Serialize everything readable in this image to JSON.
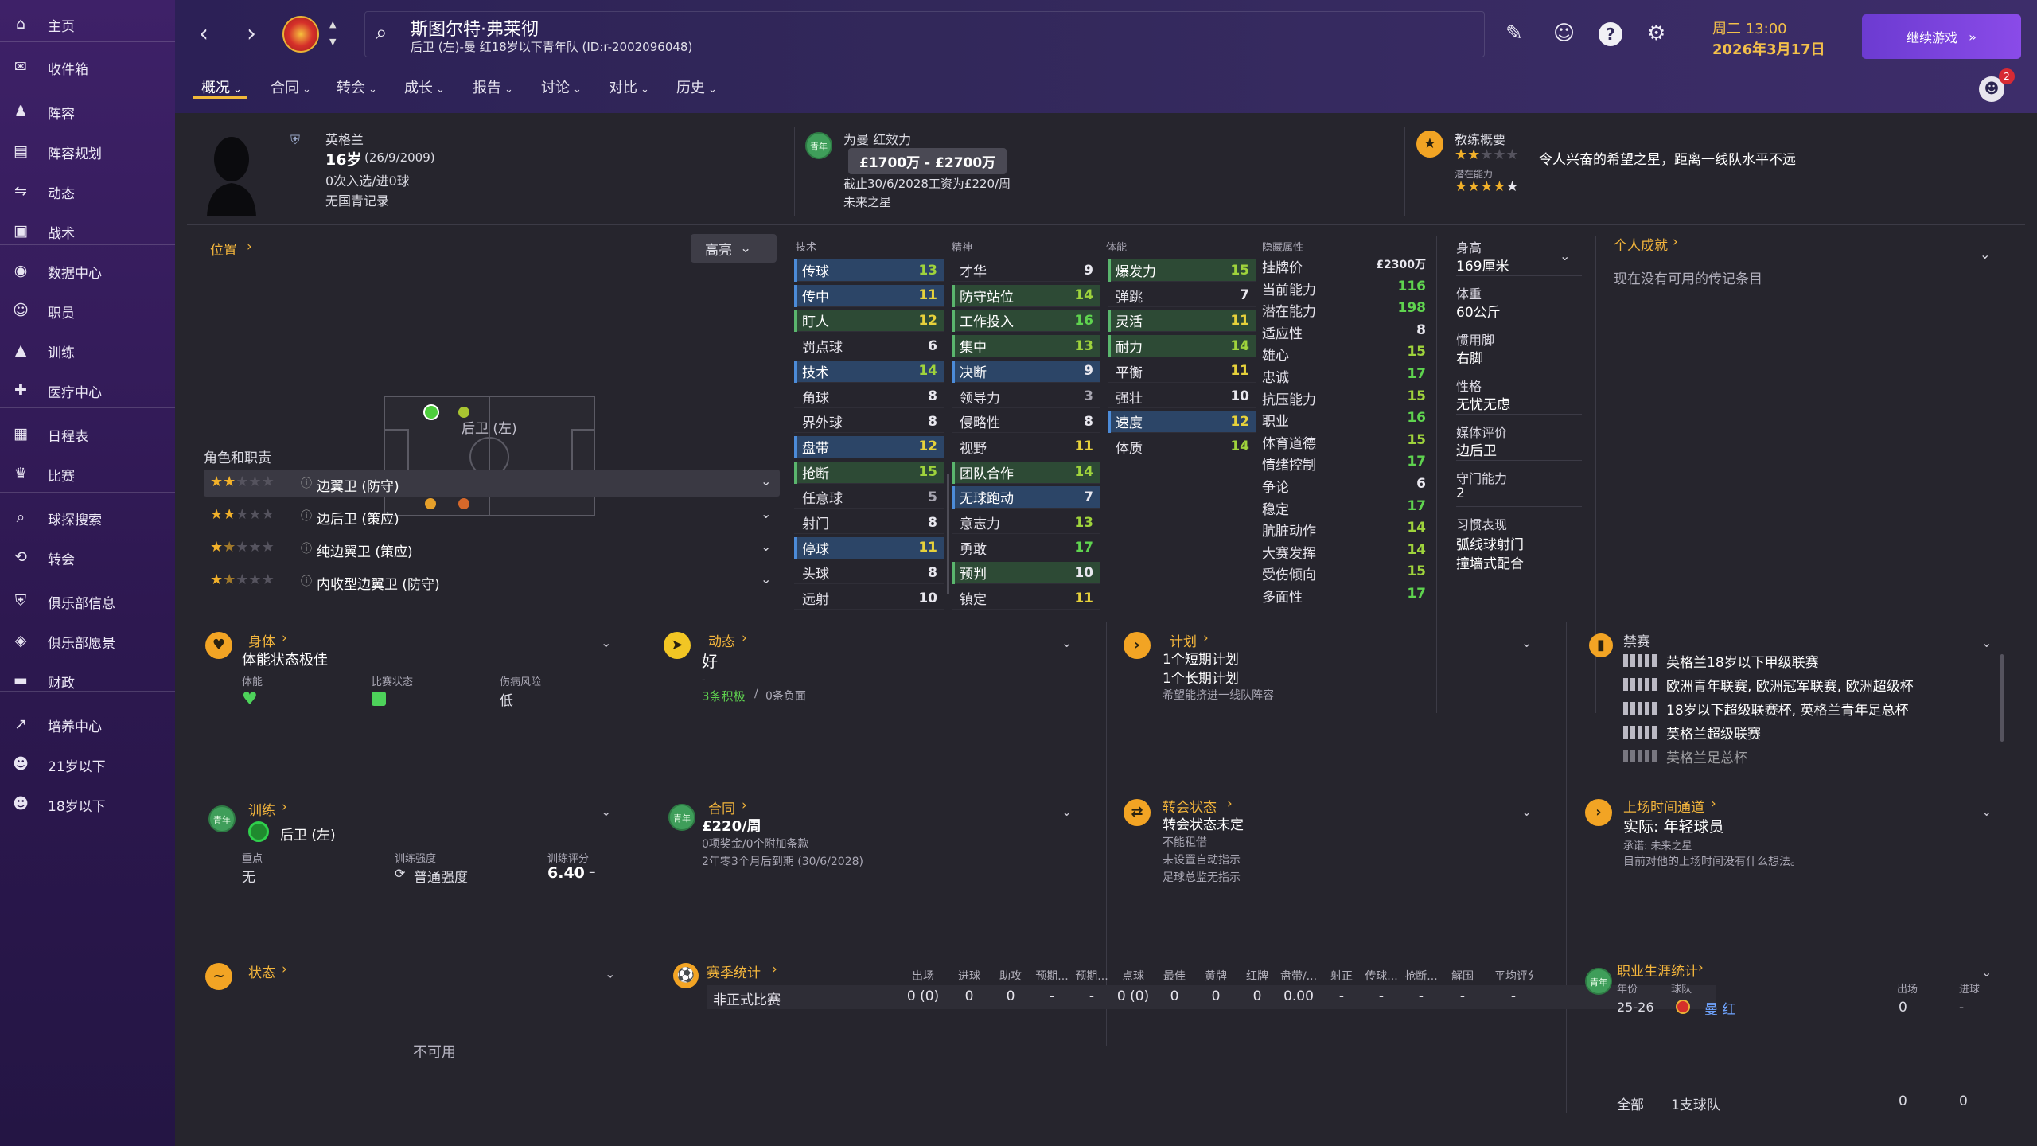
{
  "sidebar": {
    "items": [
      {
        "label": "主页",
        "icon": "home-icon"
      },
      {
        "label": "收件箱",
        "icon": "inbox-icon"
      },
      {
        "label": "阵容",
        "icon": "squad-icon"
      },
      {
        "label": "阵容规划",
        "icon": "squad-planner-icon"
      },
      {
        "label": "动态",
        "icon": "dynamics-icon"
      },
      {
        "label": "战术",
        "icon": "tactics-icon"
      },
      {
        "label": "数据中心",
        "icon": "data-hub-icon"
      },
      {
        "label": "职员",
        "icon": "staff-icon"
      },
      {
        "label": "训练",
        "icon": "training-icon"
      },
      {
        "label": "医疗中心",
        "icon": "medical-icon"
      },
      {
        "label": "日程表",
        "icon": "calendar-icon"
      },
      {
        "label": "比赛",
        "icon": "trophy-icon"
      },
      {
        "label": "球探搜索",
        "icon": "scouting-icon"
      },
      {
        "label": "转会",
        "icon": "transfers-icon"
      },
      {
        "label": "俱乐部信息",
        "icon": "club-info-icon"
      },
      {
        "label": "俱乐部愿景",
        "icon": "club-vision-icon"
      },
      {
        "label": "财政",
        "icon": "finances-icon"
      },
      {
        "label": "培养中心",
        "icon": "development-icon"
      },
      {
        "label": "21岁以下",
        "icon": "u21-icon"
      },
      {
        "label": "18岁以下",
        "icon": "u18-icon"
      }
    ]
  },
  "header": {
    "player_name": "斯图尔特·弗莱彻",
    "player_sub": "后卫 (左)-曼 红18岁以下青年队 (ID:r-2002096048)",
    "day_time": "周二 13:00",
    "date": "2026年3月17日",
    "continue_label": "继续游戏",
    "notification_count": "2"
  },
  "tabs": [
    {
      "label": "概况"
    },
    {
      "label": "合同"
    },
    {
      "label": "转会"
    },
    {
      "label": "成长"
    },
    {
      "label": "报告"
    },
    {
      "label": "讨论"
    },
    {
      "label": "对比"
    },
    {
      "label": "历史"
    }
  ],
  "profile": {
    "nationality": "英格兰",
    "age": "16岁",
    "dob": "(26/9/2009)",
    "caps": "0次入选/进0球",
    "youth_record": "无国青记录",
    "youth_badge": "青年"
  },
  "contract_summary": {
    "title": "为曼 红效力",
    "value_range": "£1700万 - £2700万",
    "expiry": "截止30/6/2028工资为£220/周",
    "future": "未来之星"
  },
  "coach_summary": {
    "title": "教练概要",
    "text": "令人兴奋的希望之星，距离一线队水平不远",
    "potential_label": "潜在能力",
    "current_stars": 2,
    "potential_stars": 4.5
  },
  "position": {
    "title": "位置",
    "highlight_label": "高亮",
    "pos_label": "后卫 (左)",
    "roles_title": "角色和职责",
    "roles": [
      {
        "name": "边翼卫 (防守)",
        "stars": 2
      },
      {
        "name": "边后卫 (策应)",
        "stars": 2
      },
      {
        "name": "纯边翼卫 (策应)",
        "stars": 1.5
      },
      {
        "name": "内收型边翼卫 (防守)",
        "stars": 1.5
      }
    ]
  },
  "attributes": {
    "headers": {
      "technical": "技术",
      "mental": "精神",
      "physical": "体能",
      "hidden": "隐藏属性"
    },
    "technical": [
      {
        "name": "传球",
        "value": "13",
        "hl": "blue"
      },
      {
        "name": "传中",
        "value": "11",
        "hl": "blue"
      },
      {
        "name": "盯人",
        "value": "12",
        "hl": "green"
      },
      {
        "name": "罚点球",
        "value": "6",
        "hl": ""
      },
      {
        "name": "技术",
        "value": "14",
        "hl": "blue"
      },
      {
        "name": "角球",
        "value": "8",
        "hl": ""
      },
      {
        "name": "界外球",
        "value": "8",
        "hl": ""
      },
      {
        "name": "盘带",
        "value": "12",
        "hl": "blue"
      },
      {
        "name": "抢断",
        "value": "15",
        "hl": "green"
      },
      {
        "name": "任意球",
        "value": "5",
        "hl": ""
      },
      {
        "name": "射门",
        "value": "8",
        "hl": ""
      },
      {
        "name": "停球",
        "value": "11",
        "hl": "blue"
      },
      {
        "name": "头球",
        "value": "8",
        "hl": ""
      },
      {
        "name": "远射",
        "value": "10",
        "hl": ""
      }
    ],
    "mental": [
      {
        "name": "才华",
        "value": "9",
        "hl": ""
      },
      {
        "name": "防守站位",
        "value": "14",
        "hl": "green"
      },
      {
        "name": "工作投入",
        "value": "16",
        "hl": "green"
      },
      {
        "name": "集中",
        "value": "13",
        "hl": "green"
      },
      {
        "name": "决断",
        "value": "9",
        "hl": "blue"
      },
      {
        "name": "领导力",
        "value": "3",
        "hl": ""
      },
      {
        "name": "侵略性",
        "value": "8",
        "hl": ""
      },
      {
        "name": "视野",
        "value": "11",
        "hl": ""
      },
      {
        "name": "团队合作",
        "value": "14",
        "hl": "green"
      },
      {
        "name": "无球跑动",
        "value": "7",
        "hl": "blue"
      },
      {
        "name": "意志力",
        "value": "13",
        "hl": ""
      },
      {
        "name": "勇敢",
        "value": "17",
        "hl": ""
      },
      {
        "name": "预判",
        "value": "10",
        "hl": "green"
      },
      {
        "name": "镇定",
        "value": "11",
        "hl": ""
      }
    ],
    "physical": [
      {
        "name": "爆发力",
        "value": "15",
        "hl": "green"
      },
      {
        "name": "弹跳",
        "value": "7",
        "hl": ""
      },
      {
        "name": "灵活",
        "value": "11",
        "hl": "green"
      },
      {
        "name": "耐力",
        "value": "14",
        "hl": "green"
      },
      {
        "name": "平衡",
        "value": "11",
        "hl": ""
      },
      {
        "name": "强壮",
        "value": "10",
        "hl": ""
      },
      {
        "name": "速度",
        "value": "12",
        "hl": "blue"
      },
      {
        "name": "体质",
        "value": "14",
        "hl": ""
      }
    ],
    "hidden": [
      {
        "name": "挂牌价",
        "value": "£2300万"
      },
      {
        "name": "当前能力",
        "value": "116"
      },
      {
        "name": "潜在能力",
        "value": "198"
      },
      {
        "name": "适应性",
        "value": "8"
      },
      {
        "name": "雄心",
        "value": "15"
      },
      {
        "name": "忠诚",
        "value": "17"
      },
      {
        "name": "抗压能力",
        "value": "15"
      },
      {
        "name": "职业",
        "value": "16"
      },
      {
        "name": "体育道德",
        "value": "15"
      },
      {
        "name": "情绪控制",
        "value": "17"
      },
      {
        "name": "争论",
        "value": "6"
      },
      {
        "name": "稳定",
        "value": "17"
      },
      {
        "name": "肮脏动作",
        "value": "14"
      },
      {
        "name": "大赛发挥",
        "value": "14"
      },
      {
        "name": "受伤倾向",
        "value": "15"
      },
      {
        "name": "多面性",
        "value": "17"
      }
    ]
  },
  "info": {
    "height_label": "身高",
    "height": "169厘米",
    "weight_label": "体重",
    "weight": "60公斤",
    "foot_label": "惯用脚",
    "foot": "右脚",
    "personality_label": "性格",
    "personality": "无忧无虑",
    "media_label": "媒体评价",
    "media": "边后卫",
    "gk_label": "守门能力",
    "gk": "2",
    "habits_label": "习惯表现",
    "habit1": "弧线球射门",
    "habit2": "撞墙式配合"
  },
  "achievements": {
    "title": "个人成就",
    "empty": "现在没有可用的传记条目"
  },
  "panels": {
    "body": {
      "title": "身体",
      "status": "体能状态极佳",
      "c1": "体能",
      "c2": "比赛状态",
      "c3": "伤病风险",
      "c3v": "低"
    },
    "dynamics": {
      "title": "动态",
      "status": "好",
      "dash": "-",
      "positive": "3条积极",
      "negative": "0条负面"
    },
    "plan": {
      "title": "计划",
      "short": "1个短期计划",
      "long": "1个长期计划",
      "note": "希望能挤进一线队阵容"
    },
    "bans": {
      "title": "禁赛",
      "items": [
        "英格兰18岁以下甲级联赛",
        "欧洲青年联赛, 欧洲冠军联赛, 欧洲超级杯",
        "18岁以下超级联赛杯, 英格兰青年足总杯",
        "英格兰超级联赛",
        "英格兰足总杯"
      ]
    },
    "training": {
      "title": "训练",
      "pos": "后卫 (左)",
      "focus_label": "重点",
      "focus": "无",
      "intensity_label": "训练强度",
      "intensity": "普通强度",
      "rating_label": "训练评分",
      "rating": "6.40"
    },
    "contract": {
      "title": "合同",
      "wage": "£220/周",
      "bonus": "0项奖金/0个附加条款",
      "expiry": "2年零3个月后到期 (30/6/2028)"
    },
    "transfer": {
      "title": "转会状态",
      "status": "转会状态未定",
      "l1": "不能租借",
      "l2": "未设置自动指示",
      "l3": "足球总监无指示"
    },
    "playing_time": {
      "title": "上场时间通道",
      "actual": "实际: 年轻球员",
      "promised": "承诺: 未来之星",
      "note": "目前对他的上场时间没有什么想法。"
    },
    "form": {
      "title": "状态",
      "na": "不可用"
    },
    "season_stats": {
      "title": "赛季统计",
      "headers": [
        "出场",
        "进球",
        "助攻",
        "预期...",
        "预期...",
        "点球",
        "最佳",
        "黄牌",
        "红牌",
        "盘带/...",
        "射正",
        "传球...",
        "抢断...",
        "解围",
        "平均评分"
      ],
      "row_label": "非正式比赛",
      "row": [
        "0 (0)",
        "0",
        "0",
        "-",
        "-",
        "0 (0)",
        "0",
        "0",
        "0",
        "0.00",
        "-",
        "-",
        "-",
        "-",
        "-"
      ]
    },
    "career": {
      "title": "职业生涯统计",
      "col_year": "年份",
      "col_team": "球队",
      "col_apps": "出场",
      "col_goals": "进球",
      "year": "25-26",
      "team": "曼 红",
      "apps": "0",
      "goals": "-",
      "total_label": "全部",
      "total_teams": "1支球队",
      "total_apps": "0",
      "total_goals": "0"
    }
  }
}
